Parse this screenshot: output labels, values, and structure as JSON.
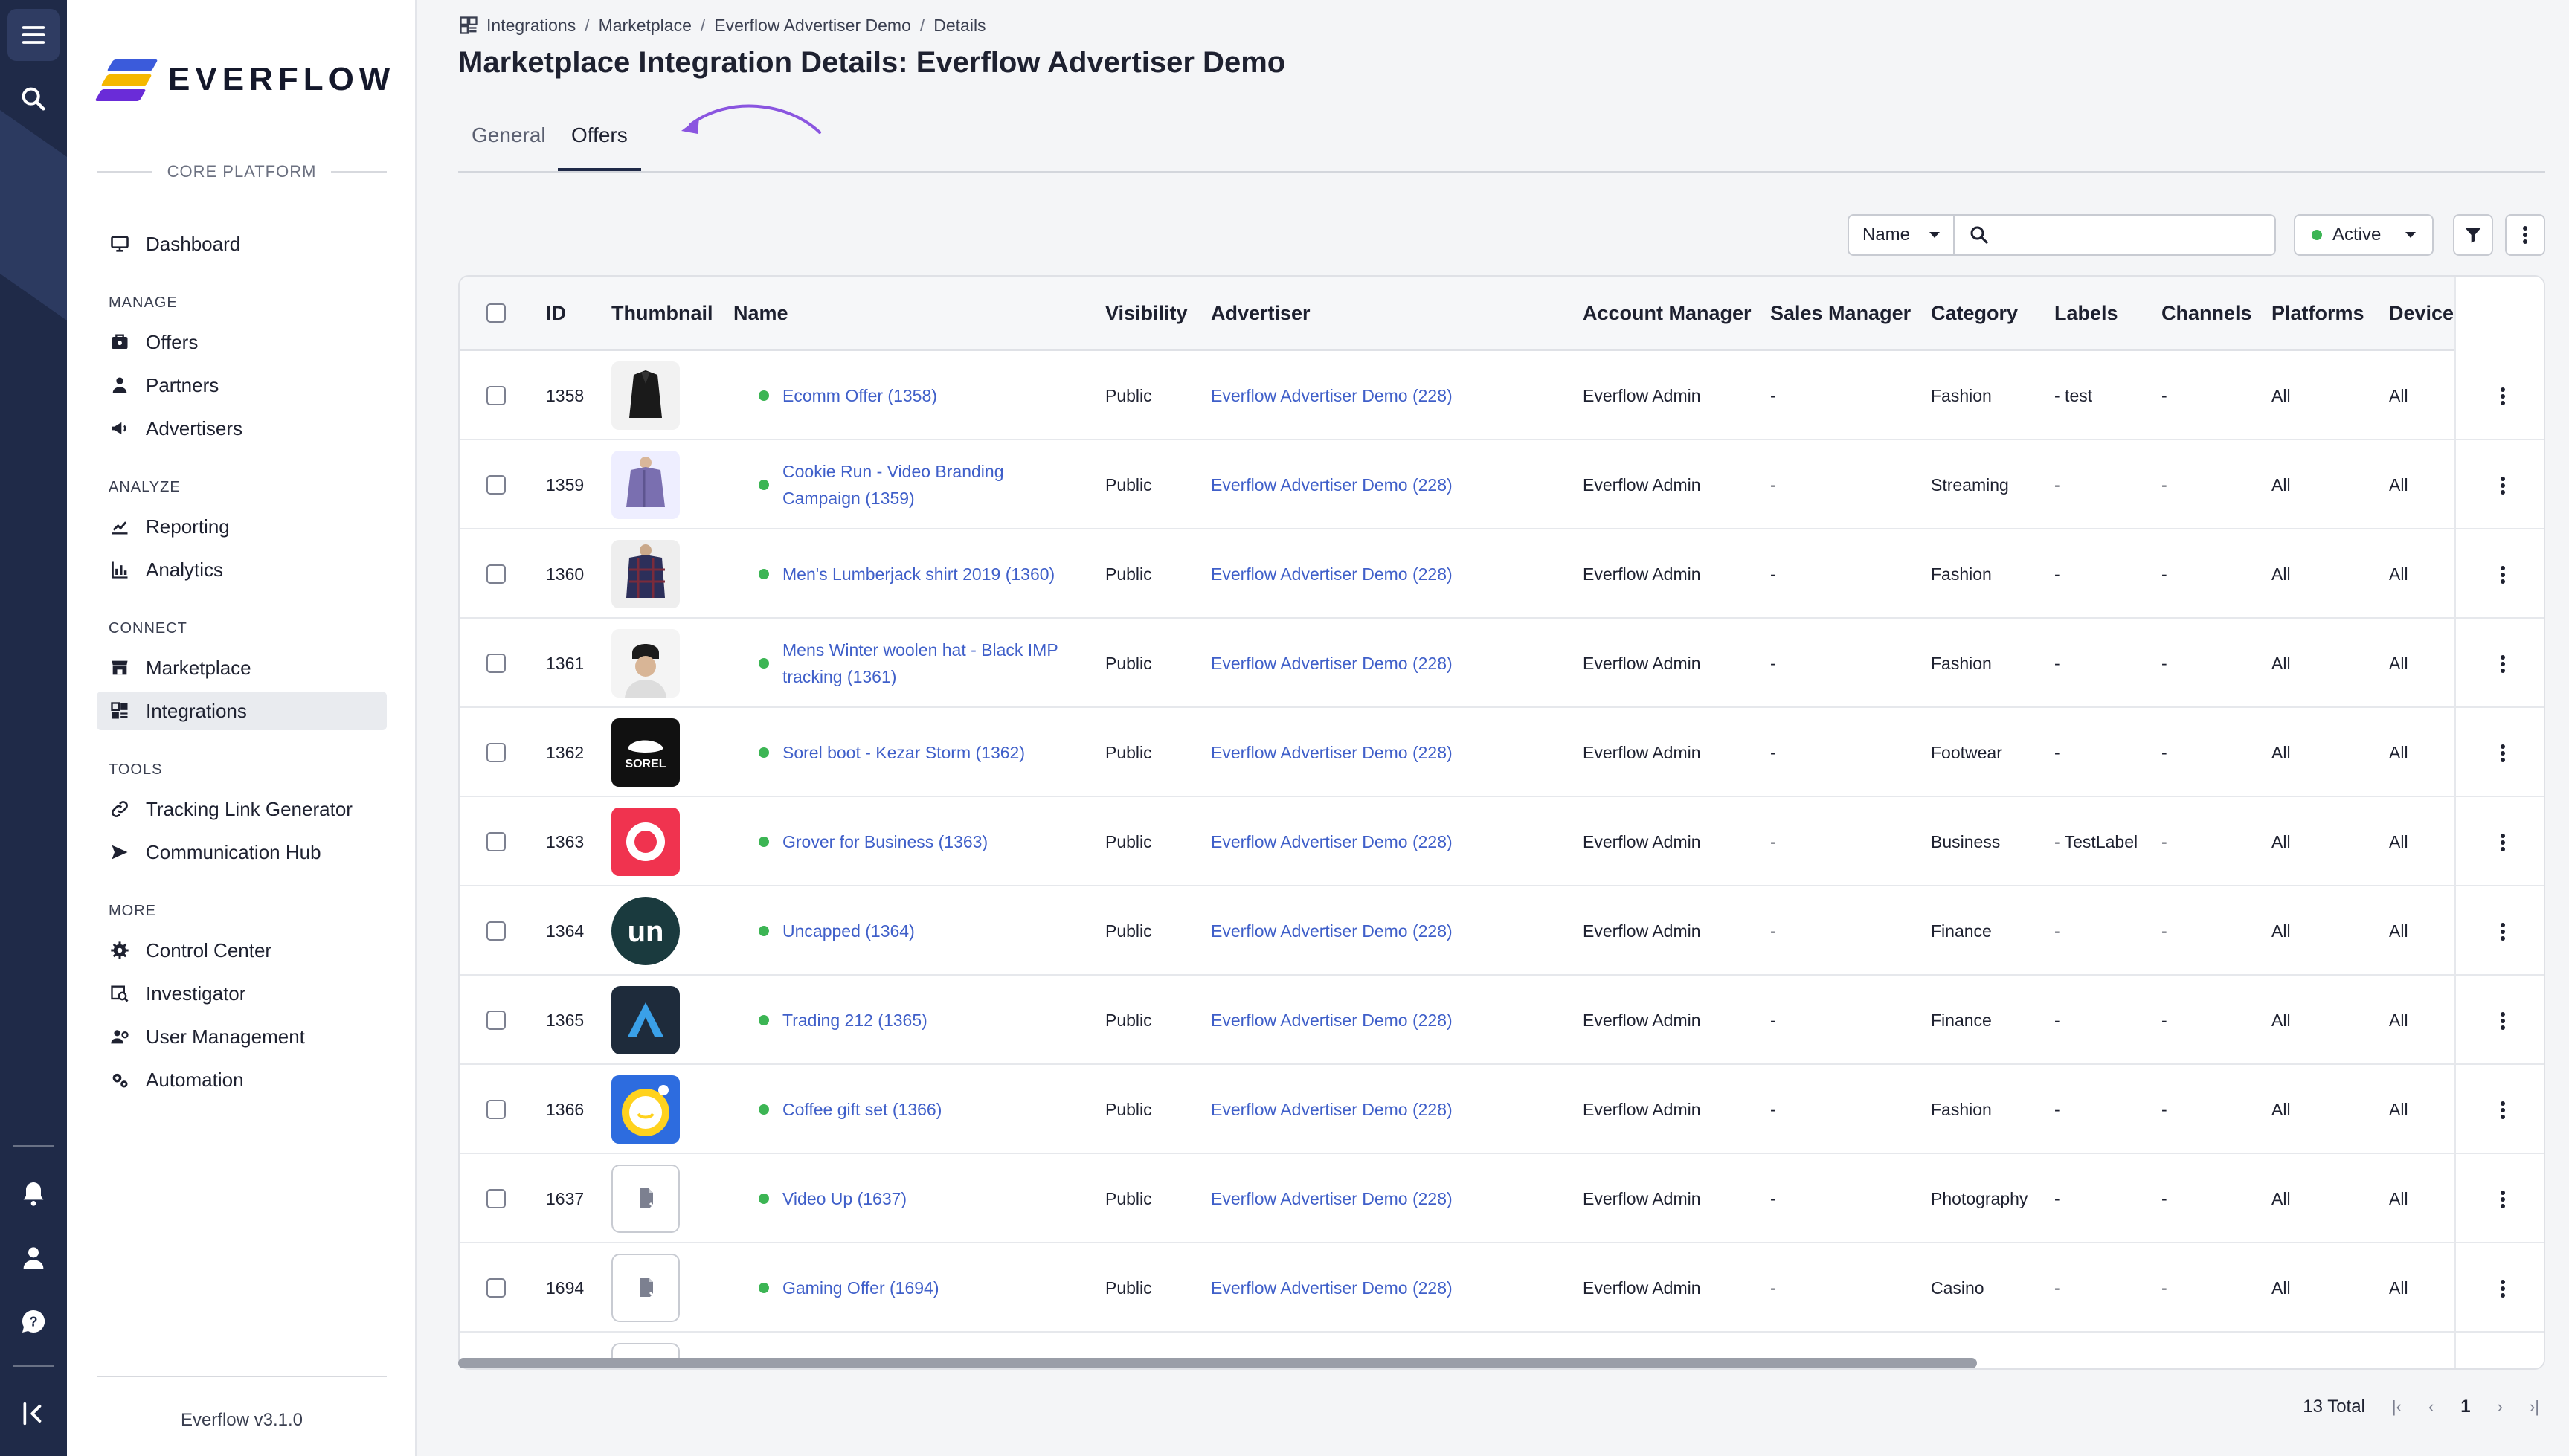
{
  "app": {
    "logo_text": "EVERFLOW",
    "version": "Everflow v3.1.0",
    "brand_colors": [
      "#f5b800",
      "#6a2cd8",
      "#3b5bdb"
    ]
  },
  "rail": {
    "icons": [
      "menu-icon",
      "search-icon",
      "bell-icon",
      "user-icon",
      "help-icon",
      "collapse-icon"
    ]
  },
  "sidebar": {
    "section_label": "CORE PLATFORM",
    "dashboard": "Dashboard",
    "groups": [
      {
        "title": "MANAGE",
        "items": [
          "Offers",
          "Partners",
          "Advertisers"
        ]
      },
      {
        "title": "ANALYZE",
        "items": [
          "Reporting",
          "Analytics"
        ]
      },
      {
        "title": "CONNECT",
        "items": [
          "Marketplace",
          "Integrations"
        ]
      },
      {
        "title": "TOOLS",
        "items": [
          "Tracking Link Generator",
          "Communication Hub"
        ]
      },
      {
        "title": "MORE",
        "items": [
          "Control Center",
          "Investigator",
          "User Management",
          "Automation"
        ]
      }
    ],
    "active_item": "Integrations"
  },
  "breadcrumb": [
    "Integrations",
    "Marketplace",
    "Everflow Advertiser Demo",
    "Details"
  ],
  "page_title": "Marketplace Integration Details: Everflow Advertiser Demo",
  "tabs": [
    {
      "label": "General"
    },
    {
      "label": "Offers"
    }
  ],
  "active_tab": "Offers",
  "toolbar": {
    "search_field": "Name",
    "search_placeholder": "",
    "status_filter": "Active",
    "status_color": "#3cb554"
  },
  "table": {
    "columns": [
      "ID",
      "Thumbnail",
      "Name",
      "Visibility",
      "Advertiser",
      "Account Manager",
      "Sales Manager",
      "Category",
      "Labels",
      "Channels",
      "Platforms",
      "Device"
    ],
    "rows": [
      {
        "id": "1358",
        "thumb": "black-coat",
        "name": "Ecomm Offer (1358)",
        "visibility": "Public",
        "advertiser": "Everflow Advertiser Demo (228)",
        "account_manager": "Everflow Admin",
        "sales_manager": "-",
        "category": "Fashion",
        "labels": "- test",
        "channels": "-",
        "platforms": "All",
        "device": "All"
      },
      {
        "id": "1359",
        "thumb": "purple-jacket",
        "name": "Cookie Run - Video Branding Campaign (1359)",
        "visibility": "Public",
        "advertiser": "Everflow Advertiser Demo (228)",
        "account_manager": "Everflow Admin",
        "sales_manager": "-",
        "category": "Streaming",
        "labels": "-",
        "channels": "-",
        "platforms": "All",
        "device": "All"
      },
      {
        "id": "1360",
        "thumb": "plaid-shirt",
        "name": "Men's Lumberjack shirt 2019 (1360)",
        "visibility": "Public",
        "advertiser": "Everflow Advertiser Demo (228)",
        "account_manager": "Everflow Admin",
        "sales_manager": "-",
        "category": "Fashion",
        "labels": "-",
        "channels": "-",
        "platforms": "All",
        "device": "All"
      },
      {
        "id": "1361",
        "thumb": "winter-hat",
        "name": "Mens Winter woolen hat - Black IMP tracking (1361)",
        "visibility": "Public",
        "advertiser": "Everflow Advertiser Demo (228)",
        "account_manager": "Everflow Admin",
        "sales_manager": "-",
        "category": "Fashion",
        "labels": "-",
        "channels": "-",
        "platforms": "All",
        "device": "All"
      },
      {
        "id": "1362",
        "thumb": "sorel-logo",
        "name": "Sorel boot - Kezar Storm (1362)",
        "visibility": "Public",
        "advertiser": "Everflow Advertiser Demo (228)",
        "account_manager": "Everflow Admin",
        "sales_manager": "-",
        "category": "Footwear",
        "labels": "-",
        "channels": "-",
        "platforms": "All",
        "device": "All"
      },
      {
        "id": "1363",
        "thumb": "grover-logo",
        "name": "Grover for Business (1363)",
        "visibility": "Public",
        "advertiser": "Everflow Advertiser Demo (228)",
        "account_manager": "Everflow Admin",
        "sales_manager": "-",
        "category": "Business",
        "labels": "- TestLabel",
        "channels": "-",
        "platforms": "All",
        "device": "All"
      },
      {
        "id": "1364",
        "thumb": "uncapped-logo",
        "name": "Uncapped (1364)",
        "visibility": "Public",
        "advertiser": "Everflow Advertiser Demo (228)",
        "account_manager": "Everflow Admin",
        "sales_manager": "-",
        "category": "Finance",
        "labels": "-",
        "channels": "-",
        "platforms": "All",
        "device": "All"
      },
      {
        "id": "1365",
        "thumb": "trading212-logo",
        "name": "Trading 212 (1365)",
        "visibility": "Public",
        "advertiser": "Everflow Advertiser Demo (228)",
        "account_manager": "Everflow Admin",
        "sales_manager": "-",
        "category": "Finance",
        "labels": "-",
        "channels": "-",
        "platforms": "All",
        "device": "All"
      },
      {
        "id": "1366",
        "thumb": "coffee-logo",
        "name": "Coffee gift set (1366)",
        "visibility": "Public",
        "advertiser": "Everflow Advertiser Demo (228)",
        "account_manager": "Everflow Admin",
        "sales_manager": "-",
        "category": "Fashion",
        "labels": "-",
        "channels": "-",
        "platforms": "All",
        "device": "All"
      },
      {
        "id": "1637",
        "thumb": "placeholder",
        "name": "Video Up (1637)",
        "visibility": "Public",
        "advertiser": "Everflow Advertiser Demo (228)",
        "account_manager": "Everflow Admin",
        "sales_manager": "-",
        "category": "Photography",
        "labels": "-",
        "channels": "-",
        "platforms": "All",
        "device": "All"
      },
      {
        "id": "1694",
        "thumb": "placeholder",
        "name": "Gaming Offer (1694)",
        "visibility": "Public",
        "advertiser": "Everflow Advertiser Demo (228)",
        "account_manager": "Everflow Admin",
        "sales_manager": "-",
        "category": "Casino",
        "labels": "-",
        "channels": "-",
        "platforms": "All",
        "device": "All"
      }
    ],
    "offer_status_color": "#3cb554",
    "link_color": "#3f5fc9"
  },
  "pagination": {
    "total_text": "13 Total",
    "first": "|‹",
    "prev": "‹",
    "current": "1",
    "next": "›",
    "last": "›|"
  }
}
